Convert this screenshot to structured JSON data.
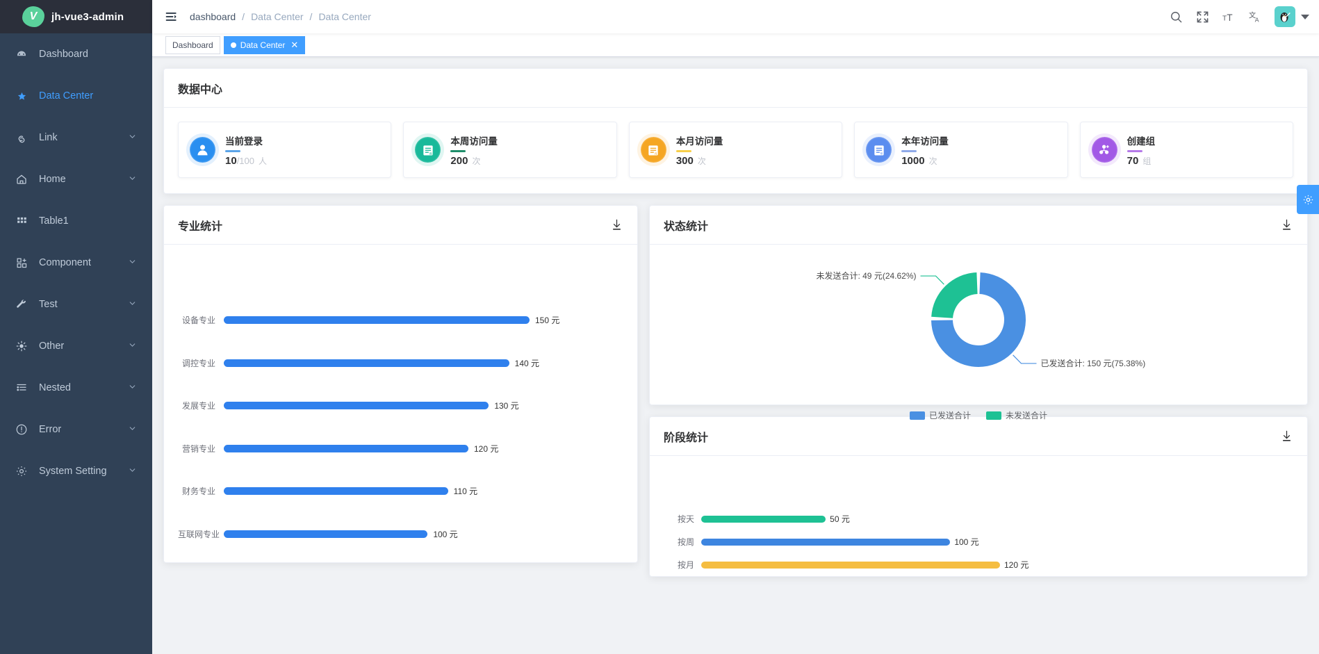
{
  "app": {
    "logo_text": "jh-vue3-admin",
    "logo_letter": "V"
  },
  "sidebar": {
    "items": [
      {
        "label": "Dashboard",
        "icon": "dashboard-icon",
        "expandable": false,
        "active": false
      },
      {
        "label": "Data Center",
        "icon": "star-icon",
        "expandable": false,
        "active": true
      },
      {
        "label": "Link",
        "icon": "link-icon",
        "expandable": true,
        "active": false
      },
      {
        "label": "Home",
        "icon": "home-icon",
        "expandable": true,
        "active": false
      },
      {
        "label": "Table1",
        "icon": "grid-icon",
        "expandable": false,
        "active": false
      },
      {
        "label": "Component",
        "icon": "component-icon",
        "expandable": true,
        "active": false
      },
      {
        "label": "Test",
        "icon": "wrench-icon",
        "expandable": true,
        "active": false
      },
      {
        "label": "Other",
        "icon": "sun-icon",
        "expandable": true,
        "active": false
      },
      {
        "label": "Nested",
        "icon": "list-icon",
        "expandable": true,
        "active": false
      },
      {
        "label": "Error",
        "icon": "alert-icon",
        "expandable": true,
        "active": false
      },
      {
        "label": "System Setting",
        "icon": "gear-icon",
        "expandable": true,
        "active": false
      }
    ],
    "arrow_glyph": "⌄"
  },
  "navbar": {
    "hamburger_icon": "hamburger-icon",
    "breadcrumb": [
      "dashboard",
      "Data Center",
      "Data Center"
    ],
    "separator": "/",
    "icons": [
      "search-icon",
      "fullscreen-icon",
      "font-size-icon",
      "translate-icon"
    ],
    "avatar_icon": "avatar-penguin-icon"
  },
  "tags": [
    {
      "label": "Dashboard",
      "active": false,
      "closable": false
    },
    {
      "label": "Data Center",
      "active": true,
      "closable": true,
      "close_glyph": "✕"
    }
  ],
  "data_center": {
    "title": "数据中心",
    "cards": [
      {
        "label": "当前登录",
        "value": "10",
        "total": "/100",
        "unit": "人",
        "icon": "user-icon",
        "color": "#2a8ff0",
        "underline": "#5ba4e8"
      },
      {
        "label": "本周访问量",
        "value": "200",
        "total": "",
        "unit": "次",
        "icon": "note-week-icon",
        "color": "#19b99a",
        "underline": "#1e8e6a"
      },
      {
        "label": "本月访问量",
        "value": "300",
        "total": "",
        "unit": "次",
        "icon": "note-month-icon",
        "color": "#f5a623",
        "underline": "#f7cf4a"
      },
      {
        "label": "本年访问量",
        "value": "1000",
        "total": "",
        "unit": "次",
        "icon": "note-year-icon",
        "color": "#5b8def",
        "underline": "#8fa9e8"
      },
      {
        "label": "创建组",
        "value": "70",
        "total": "",
        "unit": "组",
        "icon": "group-add-icon",
        "color": "#a259e6",
        "underline": "#b57ae8"
      }
    ]
  },
  "panels": {
    "major": {
      "title": "专业统计",
      "download_icon": "download-icon"
    },
    "status": {
      "title": "状态统计",
      "download_icon": "download-icon"
    },
    "stage": {
      "title": "阶段统计",
      "download_icon": "download-icon"
    }
  },
  "settings_fab": {
    "icon": "gear-icon"
  },
  "chart_data": [
    {
      "type": "bar",
      "title": "专业统计",
      "orientation": "horizontal",
      "unit": "元",
      "categories": [
        "设备专业",
        "调控专业",
        "发展专业",
        "营销专业",
        "财务专业",
        "互联网专业"
      ],
      "values": [
        150,
        140,
        130,
        120,
        110,
        100
      ],
      "labels": [
        "150 元",
        "140 元",
        "130 元",
        "120 元",
        "110 元",
        "100 元"
      ],
      "color": "#2f80ed",
      "xlabel": "",
      "ylabel": "",
      "xlim": [
        0,
        150
      ],
      "grid": false,
      "legend": "none"
    },
    {
      "type": "pie",
      "subtype": "donut",
      "title": "状态统计",
      "labels": [
        "已发送合计",
        "未发送合计"
      ],
      "values": [
        150,
        49
      ],
      "percents": [
        "75.38%",
        "24.62%"
      ],
      "annotations": [
        "未发送合计: 49 元(24.62%)",
        "已发送合计: 150 元(75.38%)"
      ],
      "colors": [
        "#4a90e2",
        "#1ec194"
      ],
      "legend": "bottom"
    },
    {
      "type": "bar",
      "title": "阶段统计",
      "orientation": "horizontal",
      "unit": "元",
      "categories": [
        "按天",
        "按周",
        "按月"
      ],
      "values": [
        50,
        100,
        120
      ],
      "labels": [
        "50 元",
        "100 元",
        "120 元"
      ],
      "colors": [
        "#1ec194",
        "#3d85e0",
        "#f5bd41"
      ],
      "xlim": [
        0,
        120
      ],
      "grid": false,
      "legend": "none"
    }
  ]
}
